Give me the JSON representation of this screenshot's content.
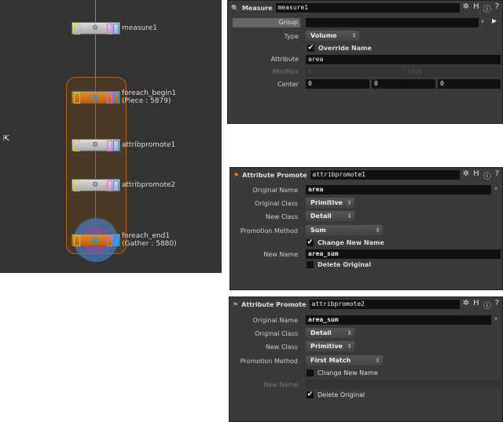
{
  "network": {
    "nodes": [
      {
        "name": "measure1",
        "label": "measure1"
      },
      {
        "name": "foreach_begin1",
        "label": "foreach_begin1\n(Piece : 5879)"
      },
      {
        "name": "attribpromote1",
        "label": "attribpromote1"
      },
      {
        "name": "attribpromote2",
        "label": "attribpromote2"
      },
      {
        "name": "foreach_end1",
        "label": "foreach_end1\n(Gather : 5880)"
      }
    ],
    "block_color": "#b8661a"
  },
  "measure_panel": {
    "type": "Measure",
    "name": "measure1",
    "group_label": "Group",
    "group_value": "",
    "type_label": "Type",
    "type_value": "Volume",
    "override_name_label": "Override Name",
    "override_name": true,
    "attribute_label": "Attribute",
    "attribute_value": "area",
    "minmax_label": "Min/Max",
    "min": "0",
    "max": "1000",
    "center_label": "Center",
    "center": [
      "0",
      "0",
      "0"
    ]
  },
  "promote1_panel": {
    "type": "Attribute Promote",
    "name": "attribpromote1",
    "original_name_label": "Original Name",
    "original_name": "area",
    "original_class_label": "Original Class",
    "original_class": "Primitive",
    "new_class_label": "New Class",
    "new_class": "Detail",
    "method_label": "Promotion Method",
    "method": "Sum",
    "change_name_label": "Change New Name",
    "change_name": true,
    "new_name_label": "New Name",
    "new_name": "area_sum",
    "delete_label": "Delete Original",
    "delete_original": false
  },
  "promote2_panel": {
    "type": "Attribute Promote",
    "name": "attribpromote2",
    "original_name_label": "Original Name",
    "original_name": "area_sum",
    "original_class_label": "Original Class",
    "original_class": "Detail",
    "new_class_label": "New Class",
    "new_class": "Primitive",
    "method_label": "Promotion Method",
    "method": "First Match",
    "change_name_label": "Change New Name",
    "change_name": false,
    "new_name_label": "New Name",
    "new_name": "",
    "delete_label": "Delete Original",
    "delete_original": true
  },
  "icons": {
    "check": "✔",
    "gear": "✲",
    "info": "ⓘ",
    "help": "?"
  }
}
